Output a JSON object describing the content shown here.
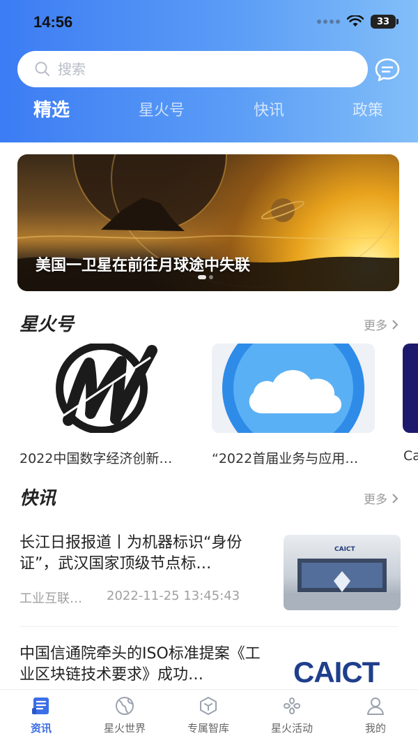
{
  "status_bar": {
    "time": "14:56",
    "battery": "33"
  },
  "search": {
    "placeholder": "搜索"
  },
  "tabs": [
    {
      "label": "精选",
      "active": true
    },
    {
      "label": "星火号",
      "active": false
    },
    {
      "label": "快讯",
      "active": false
    },
    {
      "label": "政策",
      "active": false
    }
  ],
  "banner": {
    "title": "美国一卫星在前往月球途中失联"
  },
  "xinghuo": {
    "title": "星火号",
    "more": "更多",
    "cards": [
      {
        "caption": "2022中国数字经济创新…"
      },
      {
        "caption": "“2022首届业务与应用…"
      },
      {
        "caption": "Ca"
      }
    ]
  },
  "kuaixun": {
    "title": "快讯",
    "more": "更多",
    "items": [
      {
        "title": "长江日报报道丨为机器标识“身份证”，武汉国家顶级节点标…",
        "source": "工业互联…",
        "date": "2022-11-25 13:45:43",
        "thumb_text": "CAICT"
      },
      {
        "title": "中国信通院牵头的ISO标准提案《工业区块链技术要求》成功…",
        "thumb_text": "CAICT"
      }
    ]
  },
  "tabbar": [
    {
      "label": "资讯",
      "icon": "news-icon",
      "active": true
    },
    {
      "label": "星火世界",
      "icon": "globe-icon",
      "active": false
    },
    {
      "label": "专属智库",
      "icon": "cube-icon",
      "active": false
    },
    {
      "label": "星火活动",
      "icon": "activity-icon",
      "active": false
    },
    {
      "label": "我的",
      "icon": "person-icon",
      "active": false
    }
  ],
  "colors": {
    "accent": "#3c6ee6",
    "header_start": "#3c7cf4",
    "header_end": "#82bef8"
  }
}
